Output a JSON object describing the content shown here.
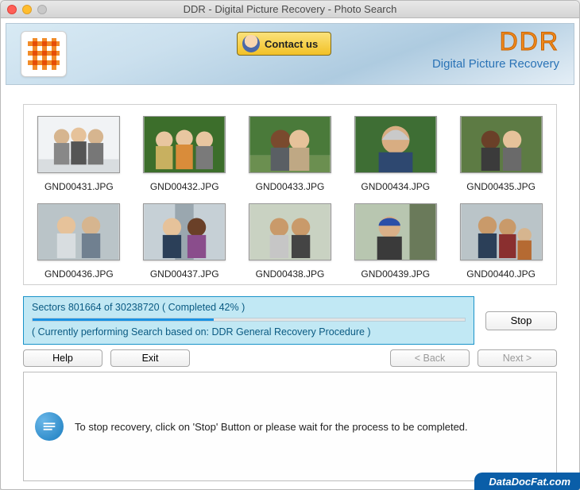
{
  "titlebar": {
    "title": "DDR - Digital Picture Recovery - Photo Search"
  },
  "banner": {
    "contact_label": "Contact us",
    "brand": "DDR",
    "brand_sub": "Digital Picture Recovery"
  },
  "gallery": {
    "items": [
      {
        "filename": "GND00431.JPG"
      },
      {
        "filename": "GND00432.JPG"
      },
      {
        "filename": "GND00433.JPG"
      },
      {
        "filename": "GND00434.JPG"
      },
      {
        "filename": "GND00435.JPG"
      },
      {
        "filename": "GND00436.JPG"
      },
      {
        "filename": "GND00437.JPG"
      },
      {
        "filename": "GND00438.JPG"
      },
      {
        "filename": "GND00439.JPG"
      },
      {
        "filename": "GND00440.JPG"
      }
    ]
  },
  "progress": {
    "line1": "Sectors 801664 of 30238720   ( Completed 42% )",
    "percent": 42,
    "line2": "( Currently performing Search based on: DDR General Recovery Procedure )",
    "stop_label": "Stop"
  },
  "nav": {
    "help": "Help",
    "exit": "Exit",
    "back": "< Back",
    "next": "Next >"
  },
  "hint": {
    "text": "To stop recovery, click on 'Stop' Button or please wait for the process to be completed."
  },
  "watermark": "DataDocFat.com"
}
